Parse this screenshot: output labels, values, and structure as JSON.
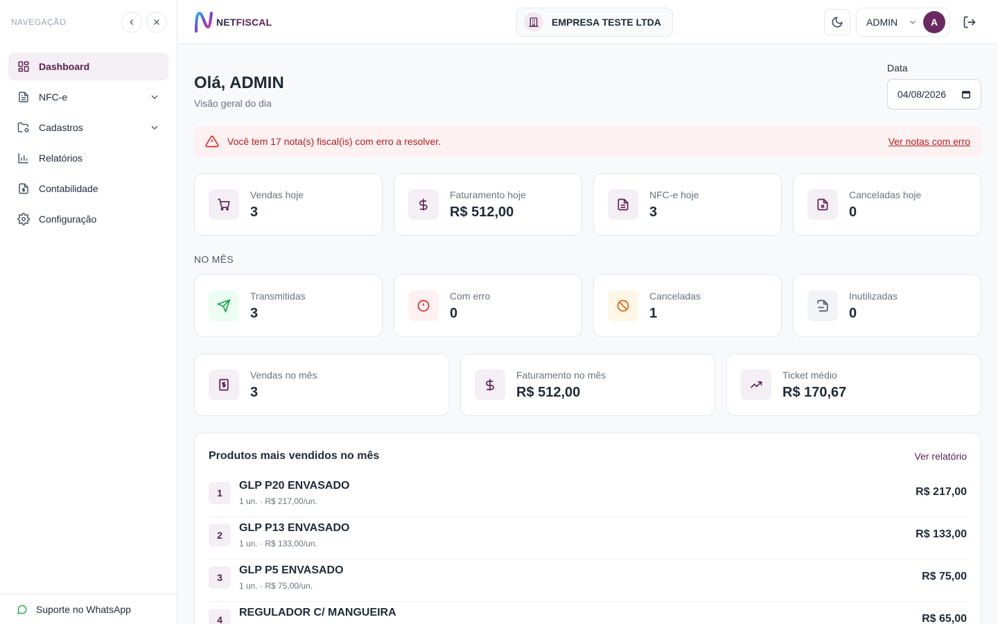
{
  "sidebar": {
    "title": "NAVEGAÇÃO",
    "items": [
      {
        "label": "Dashboard",
        "icon": "dashboard-grid-icon",
        "active": true
      },
      {
        "label": "NFC-e",
        "icon": "document-icon",
        "expandable": true
      },
      {
        "label": "Cadastros",
        "icon": "folder-settings-icon",
        "expandable": true
      },
      {
        "label": "Relatórios",
        "icon": "bar-chart-icon"
      },
      {
        "label": "Contabilidade",
        "icon": "file-dollar-icon"
      },
      {
        "label": "Configuração",
        "icon": "gear-icon"
      }
    ],
    "footer": "Suporte no WhatsApp"
  },
  "topbar": {
    "logo_prefix": "NET",
    "logo_suffix": "FISCAL",
    "company": "EMPRESA TESTE LTDA",
    "user": "ADMIN",
    "avatar_initial": "A"
  },
  "header": {
    "greeting": "Olá, ADMIN",
    "subtitle": "Visão geral do dia",
    "date_label": "Data",
    "date_value": "04/08/2026"
  },
  "alert": {
    "message": "Você tem 17 nota(s) fiscal(is) com erro a resolver.",
    "link": "Ver notas com erro"
  },
  "today_cards": [
    {
      "label": "Vendas hoje",
      "value": "3",
      "icon": "cart-icon"
    },
    {
      "label": "Faturamento hoje",
      "value": "R$ 512,00",
      "icon": "dollar-icon"
    },
    {
      "label": "NFC-e hoje",
      "value": "3",
      "icon": "document-icon"
    },
    {
      "label": "Canceladas hoje",
      "value": "0",
      "icon": "file-x-icon"
    }
  ],
  "month_label": "NO MÊS",
  "month_cards": [
    {
      "label": "Transmitidas",
      "value": "3",
      "icon": "send-icon"
    },
    {
      "label": "Com erro",
      "value": "0",
      "icon": "alert-circle-icon"
    },
    {
      "label": "Canceladas",
      "value": "1",
      "icon": "ban-icon"
    },
    {
      "label": "Inutilizadas",
      "value": "0",
      "icon": "file-minus-icon"
    }
  ],
  "summary_cards": [
    {
      "label": "Vendas no mês",
      "value": "3",
      "icon": "receipt-icon"
    },
    {
      "label": "Faturamento no mês",
      "value": "R$ 512,00",
      "icon": "dollar-icon"
    },
    {
      "label": "Ticket médio",
      "value": "R$ 170,67",
      "icon": "trending-up-icon"
    }
  ],
  "products": {
    "title": "Produtos mais vendidos no mês",
    "link": "Ver relatório",
    "rows": [
      {
        "rank": "1",
        "name": "GLP P20 ENVASADO",
        "meta": "1 un. · R$ 217,00/un.",
        "total": "R$ 217,00"
      },
      {
        "rank": "2",
        "name": "GLP P13 ENVASADO",
        "meta": "1 un. · R$ 133,00/un.",
        "total": "R$ 133,00"
      },
      {
        "rank": "3",
        "name": "GLP P5 ENVASADO",
        "meta": "1 un. · R$ 75,00/un.",
        "total": "R$ 75,00"
      },
      {
        "rank": "4",
        "name": "REGULADOR C/ MANGUEIRA",
        "meta": "",
        "total": "R$ 65,00"
      }
    ]
  },
  "colors": {
    "brand": "#5b2050",
    "danger": "#b91c1c",
    "success": "#16a34a",
    "warning": "#ea580c"
  }
}
